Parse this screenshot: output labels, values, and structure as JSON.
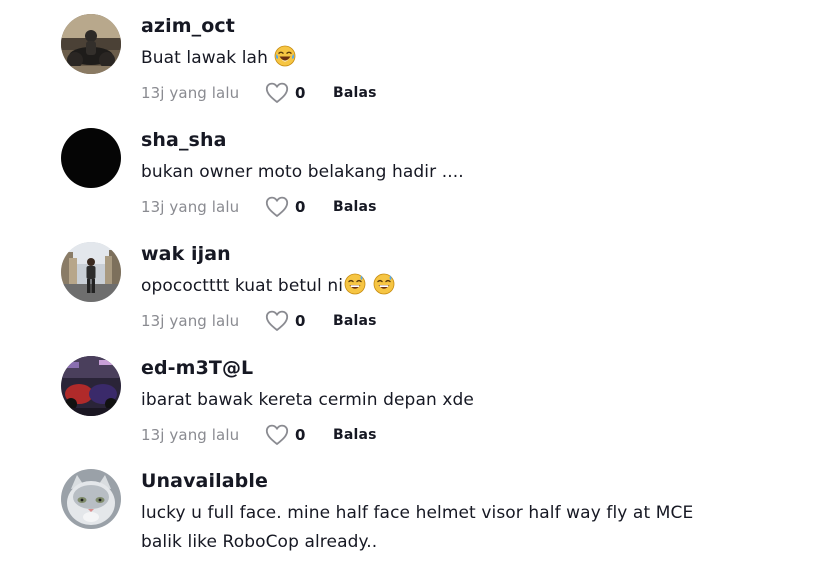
{
  "comments": [
    {
      "username": "azim_oct",
      "text": "Buat lawak lah",
      "emoji": [
        "tears-of-joy-emoji"
      ],
      "time": "13j yang lalu",
      "likes": "0",
      "reply_label": "Balas"
    },
    {
      "username": "sha_sha",
      "text": "bukan owner moto belakang hadir ....",
      "emoji": [],
      "time": "13j yang lalu",
      "likes": "0",
      "reply_label": "Balas"
    },
    {
      "username": "wak ijan",
      "text": "opococtttt kuat betul ni",
      "emoji": [
        "grinning-sweat-emoji",
        "grinning-sweat-emoji"
      ],
      "time": "13j yang lalu",
      "likes": "0",
      "reply_label": "Balas"
    },
    {
      "username": "ed-m3T@L",
      "text": "ibarat bawak kereta cermin depan xde",
      "emoji": [],
      "time": "13j yang lalu",
      "likes": "0",
      "reply_label": "Balas"
    },
    {
      "username": "Unavailable",
      "text_lines": [
        "lucky u full face. mine half face helmet visor half way fly at MCE",
        "balik like RoboCop already.."
      ]
    }
  ],
  "icons": {
    "like": "heart-outline-icon"
  },
  "colors": {
    "text_primary": "#161823",
    "text_secondary": "#8a8b91",
    "background": "#ffffff"
  }
}
